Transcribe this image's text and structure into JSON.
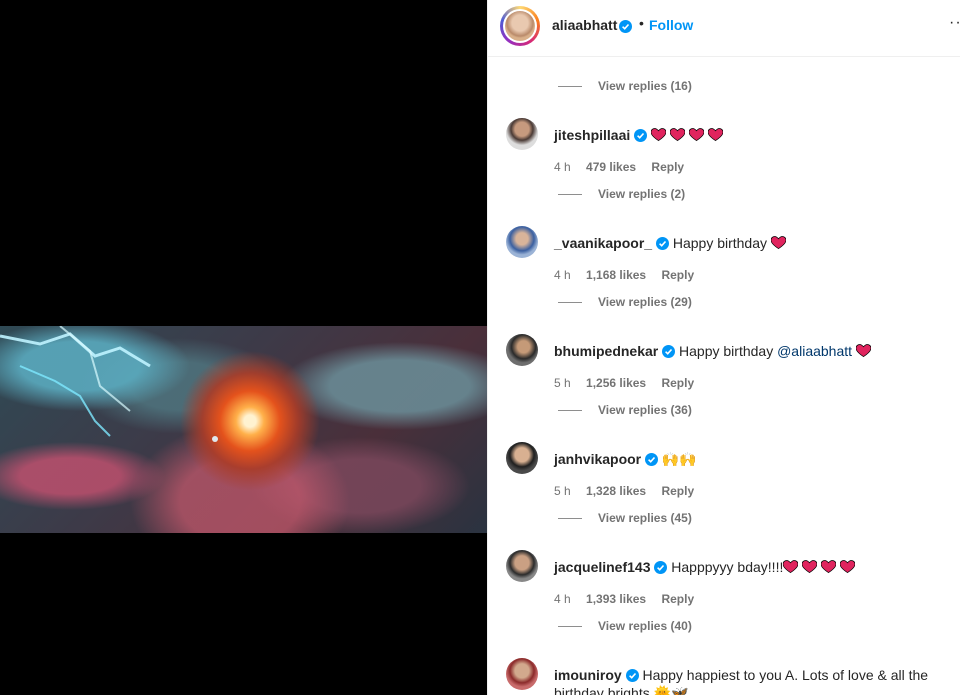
{
  "header": {
    "username": "aliaabhatt",
    "separator": "•",
    "follow_label": "Follow",
    "more_label": "··"
  },
  "thread_top": {
    "cut_text": "···",
    "view_replies": "View replies (16)"
  },
  "comments": [
    {
      "username": "jiteshpillaai",
      "text": "",
      "hearts": 4,
      "time": "4 h",
      "likes": "479 likes",
      "reply": "Reply",
      "view_replies": "View replies (2)"
    },
    {
      "username": "_vaanikapoor_",
      "text": "Happy birthday",
      "hearts": 1,
      "time": "4 h",
      "likes": "1,168 likes",
      "reply": "Reply",
      "view_replies": "View replies (29)"
    },
    {
      "username": "bhumipednekar",
      "text": "Happy birthday",
      "mention": "@aliaabhatt",
      "hearts": 1,
      "time": "5 h",
      "likes": "1,256 likes",
      "reply": "Reply",
      "view_replies": "View replies (36)"
    },
    {
      "username": "janhvikapoor",
      "text": "🙌🙌",
      "hearts": 0,
      "time": "5 h",
      "likes": "1,328 likes",
      "reply": "Reply",
      "view_replies": "View replies (45)"
    },
    {
      "username": "jacquelinef143",
      "text": "Happpyyy bday!!!!",
      "hearts": 4,
      "time": "4 h",
      "likes": "1,393 likes",
      "reply": "Reply",
      "view_replies": "View replies (40)"
    },
    {
      "username": "imouniroy",
      "text": "Happy happiest to you A. Lots of love & all the birthday brights 🌞🦋"
    }
  ],
  "colors": {
    "accent": "#0095f6",
    "verified": "#0095f6",
    "heart": "#e0245e",
    "mention": "#00376b",
    "meta": "#737373"
  },
  "icons": {
    "verified": "verified-badge-icon",
    "heart": "heart-icon",
    "more": "more-options-icon"
  }
}
